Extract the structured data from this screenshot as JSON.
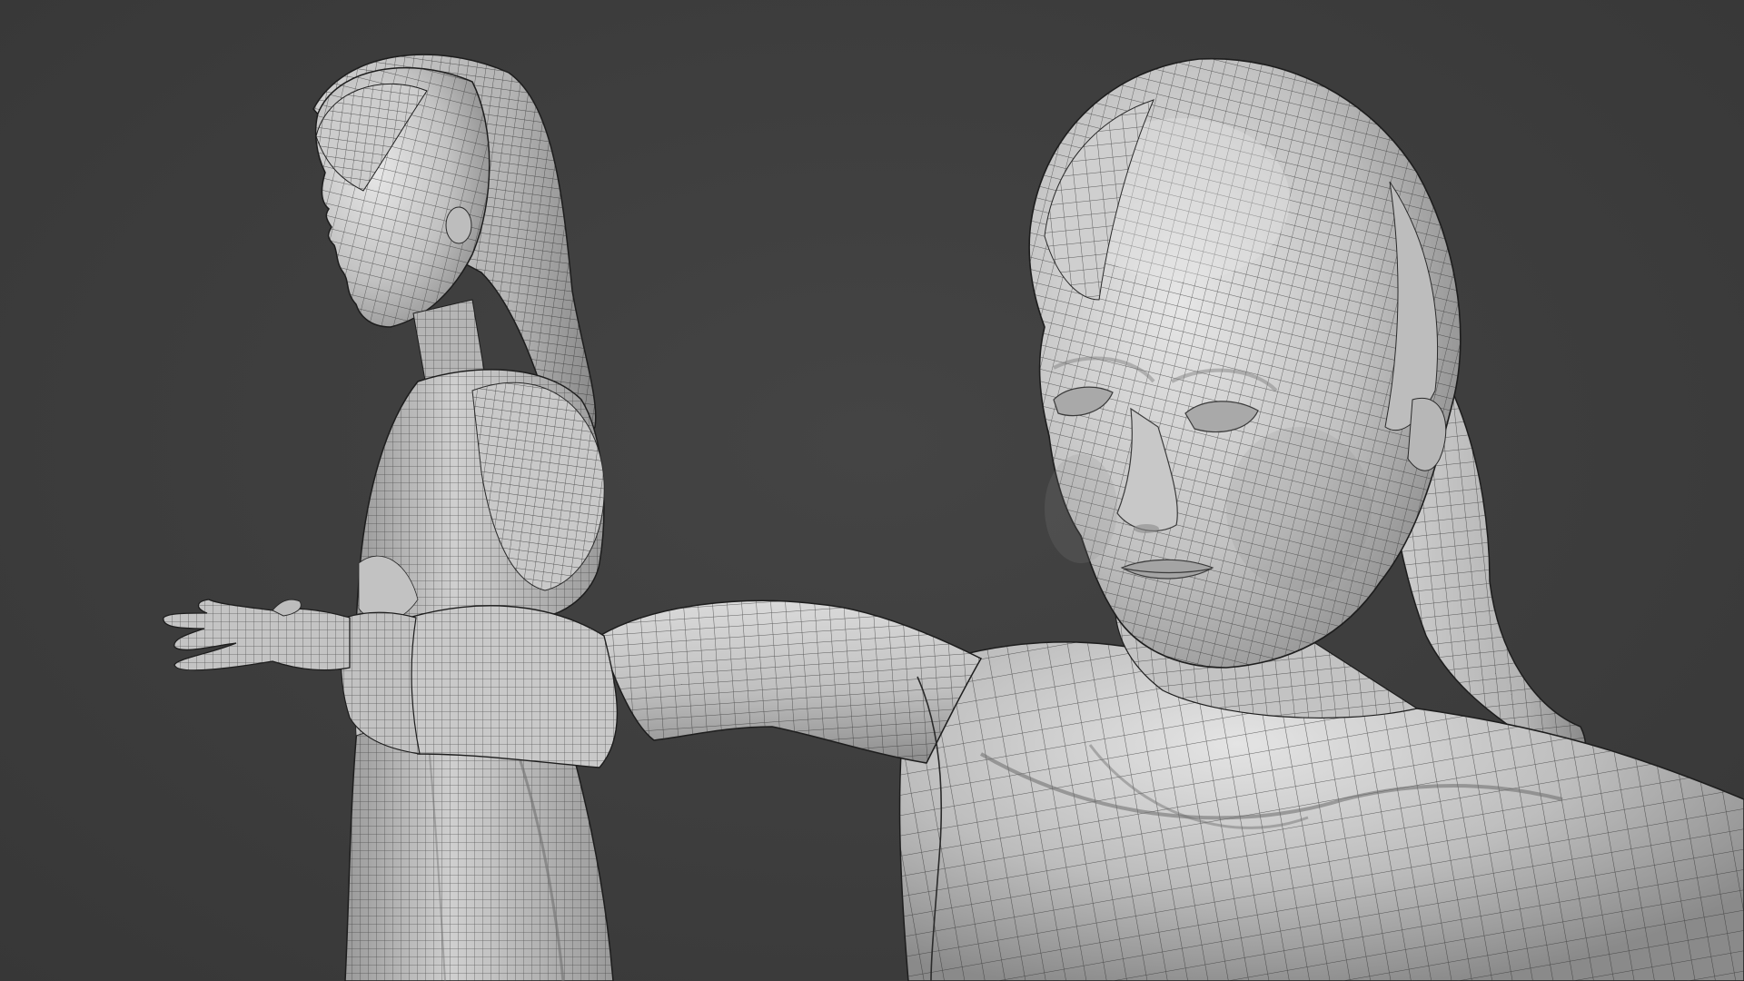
{
  "viewport": {
    "background": "#3b3b3b",
    "shading": "solid-matcap-grey",
    "overlay": "wireframe",
    "mesh_fill": "#b9b9b9",
    "mesh_highlight": "#e2e2e2",
    "mesh_shadow": "#7a7a7a",
    "wire_color": "#2e2e2e"
  },
  "models": [
    {
      "name": "female-character-side-view",
      "view": "side"
    },
    {
      "name": "female-character-closeup-three-quarter",
      "view": "three-quarter"
    }
  ]
}
